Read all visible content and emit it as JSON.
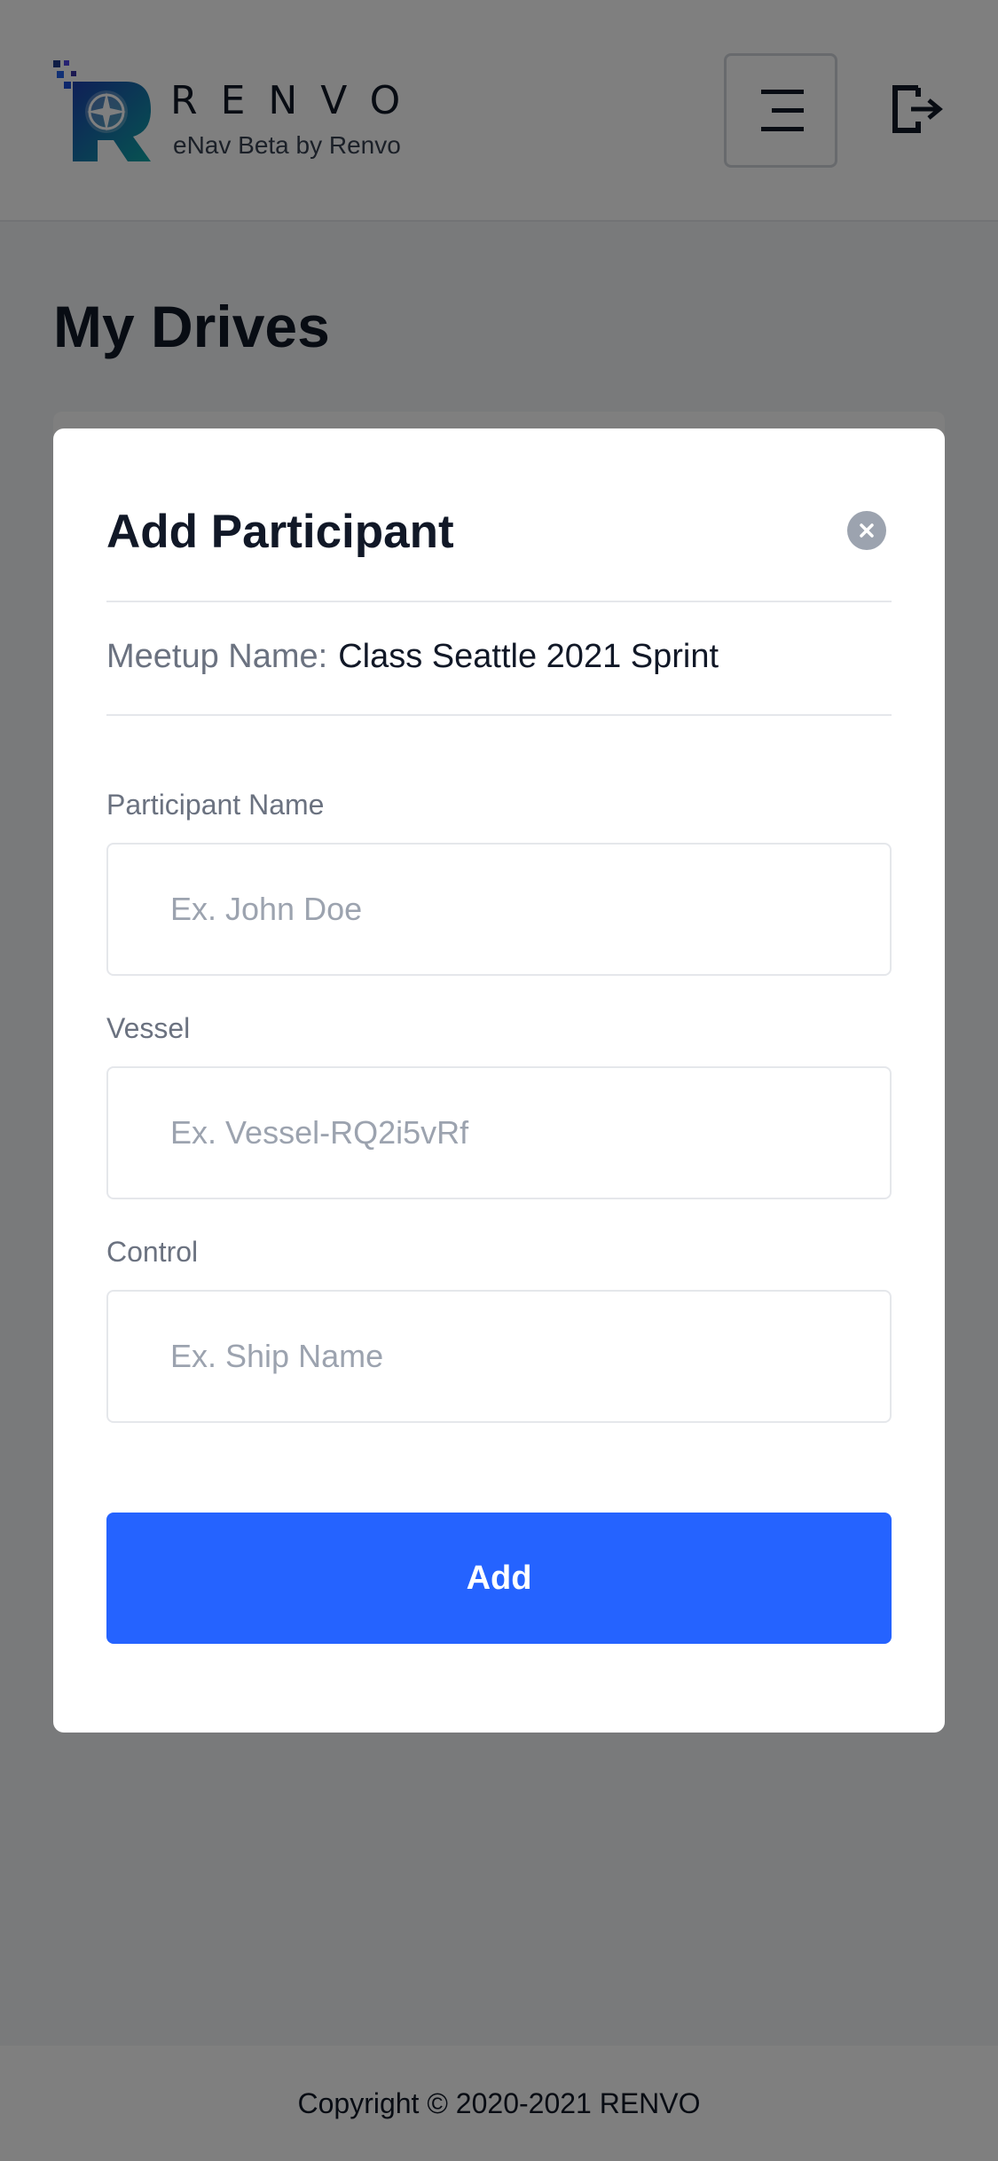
{
  "header": {
    "brand_word": "RENVO",
    "brand_sub": "eNav Beta by Renvo",
    "logo_icon": "compass-logo-icon",
    "menu_icon": "menu-icon",
    "logout_icon": "logout-icon"
  },
  "main": {
    "title": "My Drives"
  },
  "modal": {
    "title": "Add Participant",
    "close_icon": "close-icon",
    "meetup_label": "Meetup Name:",
    "meetup_value": "Class Seattle 2021 Sprint",
    "fields": [
      {
        "label": "Participant Name",
        "value": "",
        "placeholder": "Ex. John Doe"
      },
      {
        "label": "Vessel",
        "value": "",
        "placeholder": "Ex. Vessel-RQ2i5vRf"
      },
      {
        "label": "Control",
        "value": "",
        "placeholder": "Ex. Ship Name"
      }
    ],
    "add_label": "Add"
  },
  "footer": {
    "copyright": "Copyright © 2020-2021 RENVO"
  },
  "colors": {
    "primary": "#2563ff",
    "text_dark": "#111827",
    "text_muted": "#6b7280",
    "border": "#e5e7eb",
    "overlay": "rgba(0,0,0,0.5)"
  }
}
